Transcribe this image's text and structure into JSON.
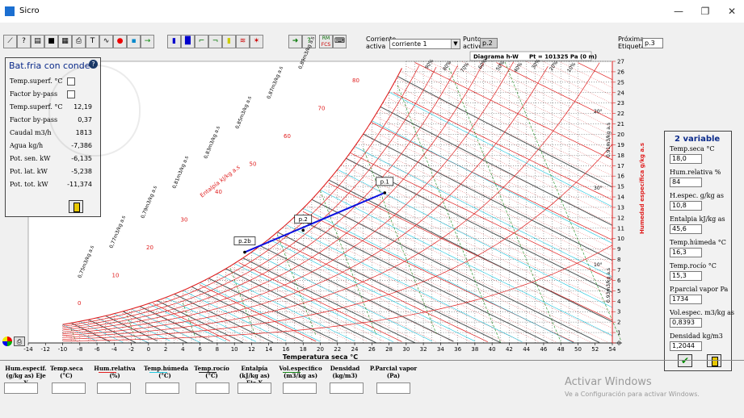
{
  "window": {
    "title": "Sicro",
    "minimize": "—",
    "restore": "❐",
    "close": "✕"
  },
  "toolbar": {
    "corriente_label_1": "Corriente",
    "corriente_label_2": "activa",
    "corriente_value": "corriente 1",
    "punto_label_1": "Punto",
    "punto_label_2": "activo",
    "punto_value": "p.2",
    "proxima_label_1": "Próxima",
    "proxima_label_2": "Etiqueta",
    "proxima_value": "p.3",
    "rm_label": "RM",
    "fcs_label": "FCS"
  },
  "left_panel": {
    "title": "Bat.fria con conde",
    "rows": [
      {
        "label": "Temp.superf. °C",
        "value": ""
      },
      {
        "label": "Factor by-pass",
        "value": ""
      },
      {
        "label": "Temp.superf. °C",
        "value": "12,19"
      },
      {
        "label": "Factor by-pass",
        "value": "0,37"
      },
      {
        "label": "Caudal m3/h",
        "value": "1813"
      },
      {
        "label": "Agua kg/h",
        "value": "-7,386"
      },
      {
        "label": "Pot. sen. kW",
        "value": "-6,135"
      },
      {
        "label": "Pot. lat. kW",
        "value": "-5,238"
      },
      {
        "label": "Pot. tot. kW",
        "value": "-11,374"
      }
    ]
  },
  "right_panel": {
    "title": "2 variable",
    "fields": [
      {
        "label": "Temp.seca °C",
        "value": "18,0"
      },
      {
        "label": "Hum.relativa %",
        "value": "84"
      },
      {
        "label": "H.espec. g/kg as",
        "value": "10,8"
      },
      {
        "label": "Entalpia kJ/kg as",
        "value": "45,6"
      },
      {
        "label": "Temp.húmeda °C",
        "value": "16,3"
      },
      {
        "label": "Temp.rocío °C",
        "value": "15,3"
      },
      {
        "label": "P.parcial vapor Pa",
        "value": "1734"
      },
      {
        "label": "Vol.espec. m3/kg as",
        "value": "0,8393"
      },
      {
        "label": "Densidad kg/m3",
        "value": "1,2044"
      }
    ]
  },
  "bottom_bar": {
    "cols": [
      {
        "line1": "Hum.especif.",
        "line2": "(g/kg as) Eje Y"
      },
      {
        "line1": "Temp.seca",
        "line2": "(°C)"
      },
      {
        "line1": "Hum.relativa",
        "line2": "(%)"
      },
      {
        "line1": "Temp.húmeda",
        "line2": "(°C)"
      },
      {
        "line1": "Temp.rocío",
        "line2": "(°C)"
      },
      {
        "line1": "Entalpía",
        "line2": "(kJ/kg as) Eje X"
      },
      {
        "line1": "Vol.especifico",
        "line2": "(m3/kg as)"
      },
      {
        "line1": "Densidad",
        "line2": "(kg/m3)"
      },
      {
        "line1": "P.Parcial vapor",
        "line2": "(Pa)"
      }
    ]
  },
  "watermark": {
    "line1": "Activar Windows",
    "line2": "Ve a Configuración para activar Windows."
  },
  "colors": {
    "rh": "#e02020",
    "wetbulb": "#22c8e0",
    "dew": "#222222",
    "vol": "#1a8a1a",
    "process": "#0a10e0",
    "enthalpy": "#e02020"
  },
  "chart_data": {
    "type": "line",
    "title": "Diagrama  h-W",
    "pressure_label": "Pt = 101325 Pa  (0 m)",
    "xlabel": "Temperatura seca °C",
    "ylabel": "Humedad específica g/kg a.s",
    "enthalpy_axis_label": "Entalpía kJ/kg a.s",
    "xlim": [
      -14,
      54
    ],
    "ylim": [
      0,
      27
    ],
    "x_ticks": [
      -14,
      -12,
      -10,
      -8,
      -6,
      -4,
      -2,
      0,
      2,
      4,
      6,
      8,
      10,
      12,
      14,
      16,
      18,
      20,
      22,
      24,
      26,
      28,
      30,
      32,
      34,
      36,
      38,
      40,
      42,
      44,
      46,
      48,
      50,
      52,
      54
    ],
    "y_ticks": [
      0,
      1,
      2,
      3,
      4,
      5,
      6,
      7,
      8,
      9,
      10,
      11,
      12,
      13,
      14,
      15,
      16,
      17,
      18,
      19,
      20,
      21,
      22,
      23,
      24,
      25,
      26,
      27
    ],
    "enthalpy_labels": [
      0,
      10,
      20,
      30,
      40,
      50,
      60,
      70,
      80
    ],
    "volume_labels": [
      "0,75m3/kg a.s",
      "0,77m3/kg a.s",
      "0,79m3/kg a.s",
      "0,81m3/kg a.s",
      "0,83m3/kg a.s",
      "0,85m3/kg a.s",
      "0,87m3/kg a.s",
      "0,89m3/kg a.s"
    ],
    "rh_labels": [
      "10%",
      "20%",
      "30%",
      "40%",
      "50%",
      "60%",
      "70%",
      "80%",
      "90%"
    ],
    "right_curve_labels": [
      "0,91m3/kg a.s",
      "0,93m3/kg a.s",
      "20°",
      "30°",
      "10°"
    ],
    "points": [
      {
        "name": "p.1",
        "x": 27.5,
        "y": 14.4
      },
      {
        "name": "p.2",
        "x": 18.0,
        "y": 10.8
      },
      {
        "name": "p.2b",
        "x": 11.2,
        "y": 8.7
      }
    ]
  }
}
